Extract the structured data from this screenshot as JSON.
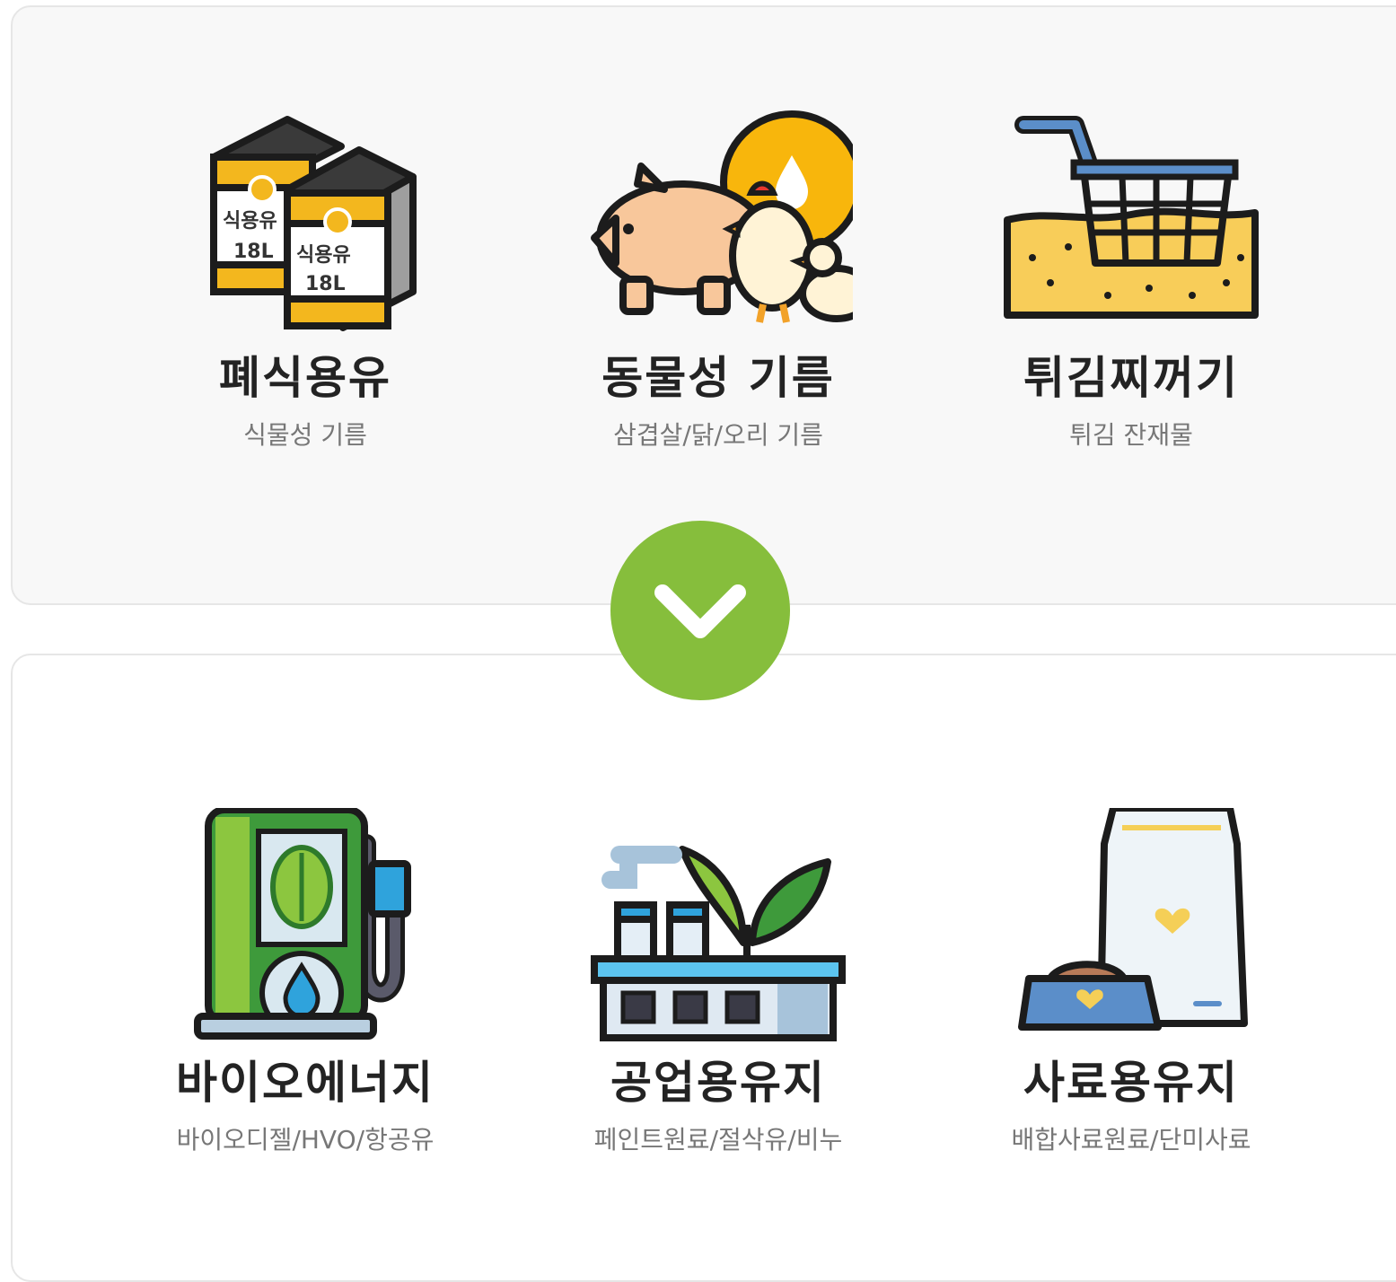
{
  "sources": [
    {
      "title": "폐식용유",
      "subtitle": "식물성 기름",
      "icon": "oil-can-icon",
      "can_label": "식용유",
      "can_volume": "18L"
    },
    {
      "title": "동물성 기름",
      "subtitle": "삼겹살/닭/오리 기름",
      "icon": "animals-icon"
    },
    {
      "title": "튀김찌꺼기",
      "subtitle": "튀김 잔재물",
      "icon": "fryer-basket-icon"
    }
  ],
  "flow_icon": "chevron-down-icon",
  "products": [
    {
      "title": "바이오에너지",
      "subtitle": "바이오디젤/HVO/항공유",
      "icon": "fuel-pump-icon"
    },
    {
      "title": "공업용유지",
      "subtitle": "페인트원료/절삭유/비누",
      "icon": "factory-plant-icon"
    },
    {
      "title": "사료용유지",
      "subtitle": "배합사료원료/단미사료",
      "icon": "pet-food-icon"
    }
  ],
  "colors": {
    "accent_green": "#86be3c",
    "title_text": "#232323",
    "subtitle_text": "#777777"
  }
}
